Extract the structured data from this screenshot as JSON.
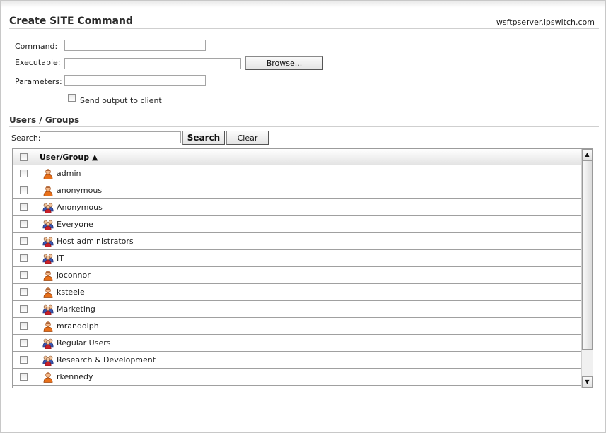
{
  "page": {
    "title": "Create SITE Command",
    "server": "wsftpserver.ipswitch.com"
  },
  "form": {
    "command_label": "Command:",
    "command_value": "",
    "executable_label": "Executable:",
    "executable_value": "",
    "browse_label": "Browse...",
    "parameters_label": "Parameters:",
    "parameters_value": "",
    "send_output_label": "Send output to client",
    "send_output_checked": false
  },
  "users_groups": {
    "section_title": "Users / Groups",
    "search_label": "Search:",
    "search_value": "",
    "search_button": "Search",
    "clear_button": "Clear",
    "column_header": "User/Group ▲",
    "rows": [
      {
        "name": "admin",
        "kind": "user",
        "icon": "user-icon",
        "checked": false
      },
      {
        "name": "anonymous",
        "kind": "user",
        "icon": "user-icon",
        "checked": false
      },
      {
        "name": "Anonymous",
        "kind": "group",
        "icon": "group-icon",
        "checked": false
      },
      {
        "name": "Everyone",
        "kind": "group",
        "icon": "group-icon",
        "checked": false
      },
      {
        "name": "Host administrators",
        "kind": "group",
        "icon": "group-icon",
        "checked": false
      },
      {
        "name": "IT",
        "kind": "group",
        "icon": "group-icon",
        "checked": false
      },
      {
        "name": "joconnor",
        "kind": "user",
        "icon": "user-icon",
        "checked": false
      },
      {
        "name": "ksteele",
        "kind": "user",
        "icon": "user-icon",
        "checked": false
      },
      {
        "name": "Marketing",
        "kind": "group",
        "icon": "group-icon",
        "checked": false
      },
      {
        "name": "mrandolph",
        "kind": "user",
        "icon": "user-icon",
        "checked": false
      },
      {
        "name": "Regular Users",
        "kind": "group",
        "icon": "group-icon",
        "checked": false
      },
      {
        "name": "Research & Development",
        "kind": "group",
        "icon": "group-icon",
        "checked": false
      },
      {
        "name": "rkennedy",
        "kind": "user",
        "icon": "user-icon",
        "checked": false
      }
    ],
    "scroll_up_icon": "scroll-up-arrow-icon",
    "scroll_down_icon": "scroll-down-arrow-icon"
  }
}
